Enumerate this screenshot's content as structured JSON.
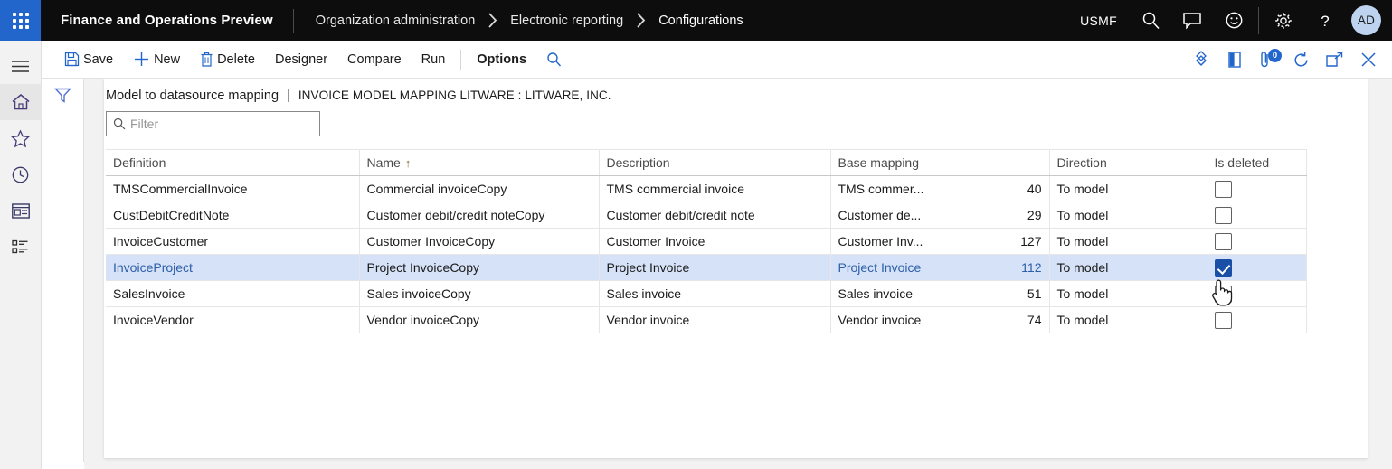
{
  "topbar": {
    "waffle_icon": "app-launcher-icon",
    "app_title": "Finance and Operations Preview",
    "breadcrumb": [
      "Organization administration",
      "Electronic reporting",
      "Configurations"
    ],
    "company": "USMF",
    "icons": [
      "search-icon",
      "message-icon",
      "feedback-smiley-icon",
      "settings-gear-icon",
      "help-question-icon"
    ],
    "avatar_initials": "AD"
  },
  "rail": {
    "items": [
      {
        "name": "navigation-menu-icon",
        "label": "Expand the navigation pane"
      },
      {
        "name": "home-icon",
        "label": "Home"
      },
      {
        "name": "favorites-star-icon",
        "label": "Favorites"
      },
      {
        "name": "recent-clock-icon",
        "label": "Recent"
      },
      {
        "name": "workspaces-icon",
        "label": "Workspaces"
      },
      {
        "name": "modules-list-icon",
        "label": "Modules"
      }
    ]
  },
  "toolbar": {
    "save_label": "Save",
    "new_label": "New",
    "delete_label": "Delete",
    "designer_label": "Designer",
    "compare_label": "Compare",
    "run_label": "Run",
    "options_label": "Options",
    "search_icon": "search-icon",
    "right_icons": [
      {
        "name": "personalize-icon"
      },
      {
        "name": "open-in-new-window-icon"
      },
      {
        "name": "attachments-icon",
        "badge": "0"
      },
      {
        "name": "refresh-icon"
      },
      {
        "name": "popout-icon"
      },
      {
        "name": "close-icon"
      }
    ]
  },
  "filter_strip": {
    "icon": "filter-funnel-icon"
  },
  "page": {
    "title": "Model to datasource mapping",
    "separator": "|",
    "subtitle": "INVOICE MODEL MAPPING LITWARE : LITWARE, INC.",
    "filter_placeholder": "Filter",
    "filter_value": ""
  },
  "grid": {
    "columns": [
      {
        "key": "definition",
        "label": "Definition",
        "sort": ""
      },
      {
        "key": "name",
        "label": "Name",
        "sort": "↑"
      },
      {
        "key": "description",
        "label": "Description",
        "sort": ""
      },
      {
        "key": "base_mapping",
        "label": "Base mapping",
        "sort": ""
      },
      {
        "key": "direction",
        "label": "Direction",
        "sort": ""
      },
      {
        "key": "is_deleted",
        "label": "Is deleted",
        "sort": ""
      }
    ],
    "rows": [
      {
        "definition": "TMSCommercialInvoice",
        "name": "Commercial invoiceCopy",
        "description": "TMS commercial invoice",
        "base_mapping_text": "TMS commer...",
        "base_mapping_num": "40",
        "direction": "To model",
        "is_deleted": false,
        "selected": false
      },
      {
        "definition": "CustDebitCreditNote",
        "name": "Customer debit/credit noteCopy",
        "description": "Customer debit/credit note",
        "base_mapping_text": "Customer de...",
        "base_mapping_num": "29",
        "direction": "To model",
        "is_deleted": false,
        "selected": false
      },
      {
        "definition": "InvoiceCustomer",
        "name": "Customer InvoiceCopy",
        "description": "Customer Invoice",
        "base_mapping_text": "Customer Inv...",
        "base_mapping_num": "127",
        "direction": "To model",
        "is_deleted": false,
        "selected": false
      },
      {
        "definition": "InvoiceProject",
        "name": "Project InvoiceCopy",
        "description": "Project Invoice",
        "base_mapping_text": "Project Invoice",
        "base_mapping_num": "112",
        "direction": "To model",
        "is_deleted": true,
        "selected": true
      },
      {
        "definition": "SalesInvoice",
        "name": "Sales invoiceCopy",
        "description": "Sales invoice",
        "base_mapping_text": "Sales invoice",
        "base_mapping_num": "51",
        "direction": "To model",
        "is_deleted": false,
        "selected": false
      },
      {
        "definition": "InvoiceVendor",
        "name": "Vendor invoiceCopy",
        "description": "Vendor invoice",
        "base_mapping_text": "Vendor invoice",
        "base_mapping_num": "74",
        "direction": "To model",
        "is_deleted": false,
        "selected": false
      }
    ]
  },
  "colors": {
    "topbar_bg": "#0d0d0d",
    "accent_blue": "#2266cc",
    "selected_row": "#d6e2f7",
    "checkbox_checked": "#1a4fa8",
    "avatar_bg": "#bdd3f0",
    "link_text": "#2c5fa8"
  },
  "cursor": {
    "type": "pointing-hand-cursor"
  }
}
